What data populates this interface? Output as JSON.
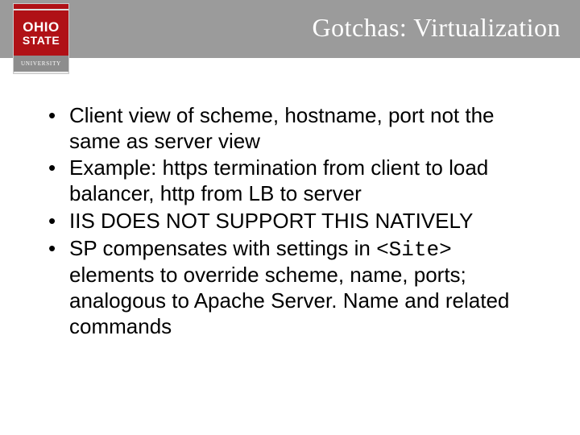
{
  "header": {
    "title": "Gotchas: Virtualization",
    "logo": {
      "line1": "OHIO",
      "line2": "STATE",
      "subtitle": "UNIVERSITY"
    }
  },
  "bullets": [
    {
      "parts": [
        {
          "text": "Client view of scheme, hostname, port not the same as server view",
          "mono": false
        }
      ]
    },
    {
      "parts": [
        {
          "text": "Example: https termination from client to load balancer, http from LB to server",
          "mono": false
        }
      ]
    },
    {
      "parts": [
        {
          "text": "IIS DOES NOT SUPPORT THIS NATIVELY",
          "mono": false
        }
      ]
    },
    {
      "parts": [
        {
          "text": "SP compensates with settings in ",
          "mono": false
        },
        {
          "text": "<Site>",
          "mono": true
        },
        {
          "text": " elements to override scheme, name, ports; analogous to Apache Server. Name and related commands",
          "mono": false
        }
      ]
    }
  ]
}
